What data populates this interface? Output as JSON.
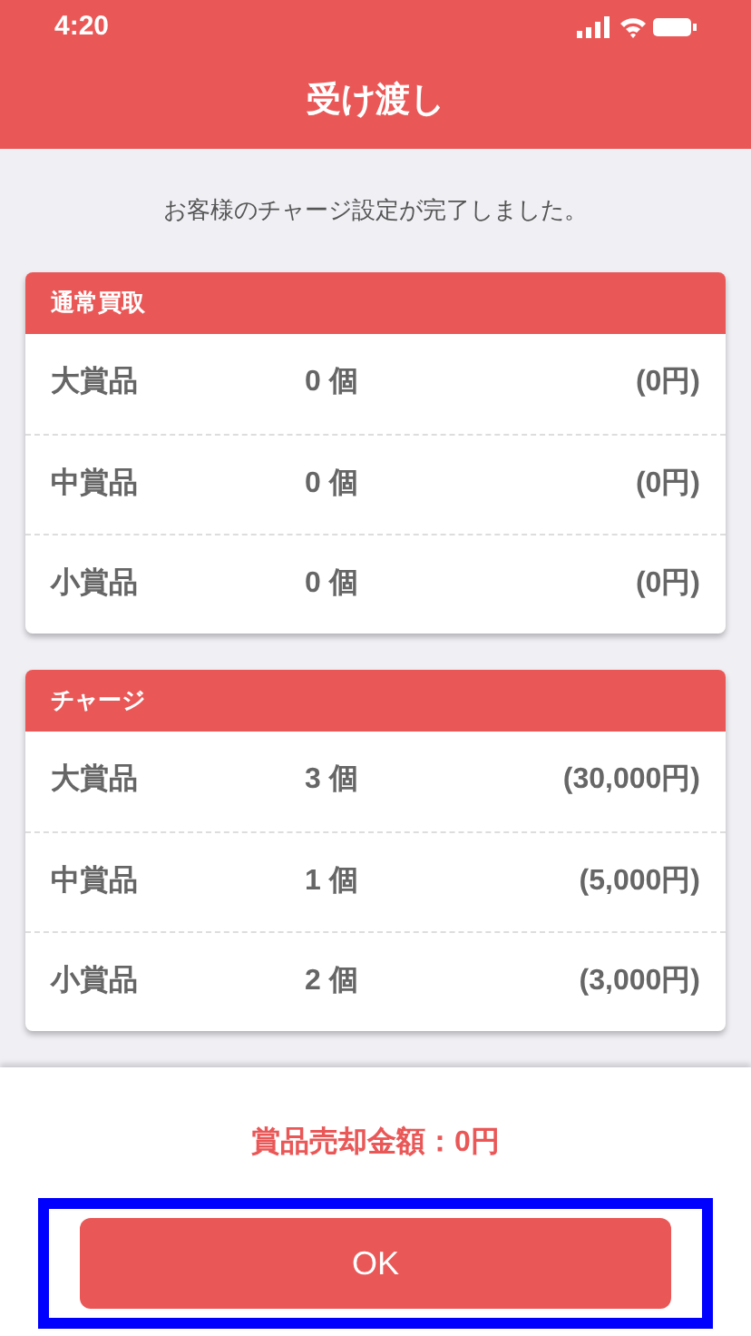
{
  "status_bar": {
    "time": "4:20"
  },
  "header": {
    "title": "受け渡し"
  },
  "message": "お客様のチャージ設定が完了しました。",
  "sections": [
    {
      "title": "通常買取",
      "rows": [
        {
          "name": "大賞品",
          "count": "0 個",
          "amount": "(0円)"
        },
        {
          "name": "中賞品",
          "count": "0 個",
          "amount": "(0円)"
        },
        {
          "name": "小賞品",
          "count": "0 個",
          "amount": "(0円)"
        }
      ]
    },
    {
      "title": "チャージ",
      "rows": [
        {
          "name": "大賞品",
          "count": "3 個",
          "amount": "(30,000円)"
        },
        {
          "name": "中賞品",
          "count": "1 個",
          "amount": "(5,000円)"
        },
        {
          "name": "小賞品",
          "count": "2 個",
          "amount": "(3,000円)"
        }
      ]
    }
  ],
  "footer": {
    "total": "賞品売却金額：0円",
    "ok_button": {
      "label": "OK",
      "highlighted": true
    }
  }
}
